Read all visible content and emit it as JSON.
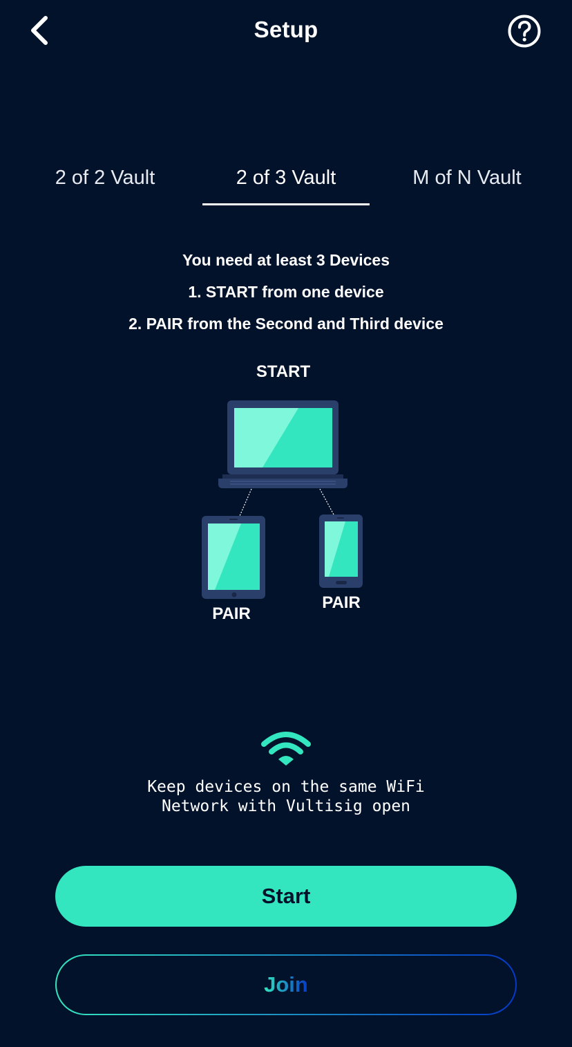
{
  "header": {
    "title": "Setup",
    "back_icon": "chevron-left-icon",
    "help_icon": "question-circle-icon"
  },
  "tabs": [
    {
      "label": "2 of 2 Vault",
      "selected": false
    },
    {
      "label": "2 of 3 Vault",
      "selected": true
    },
    {
      "label": "M of N Vault",
      "selected": false
    }
  ],
  "instructions": {
    "line1": "You need at least 3 Devices",
    "line2": "1. START from one device",
    "line3": "2. PAIR from the Second and Third device"
  },
  "diagram": {
    "start_label": "START",
    "tablet_label": "PAIR",
    "phone_label": "PAIR"
  },
  "wifi": {
    "icon": "wifi-icon",
    "note": "Keep devices on the same WiFi\nNetwork with Vultisig open"
  },
  "actions": {
    "start_label": "Start",
    "join_label": "Join"
  },
  "colors": {
    "background": "#02122b",
    "accent": "#33e6bf",
    "device_frame": "#2b3f6b",
    "gradient_end": "#0439c7"
  }
}
